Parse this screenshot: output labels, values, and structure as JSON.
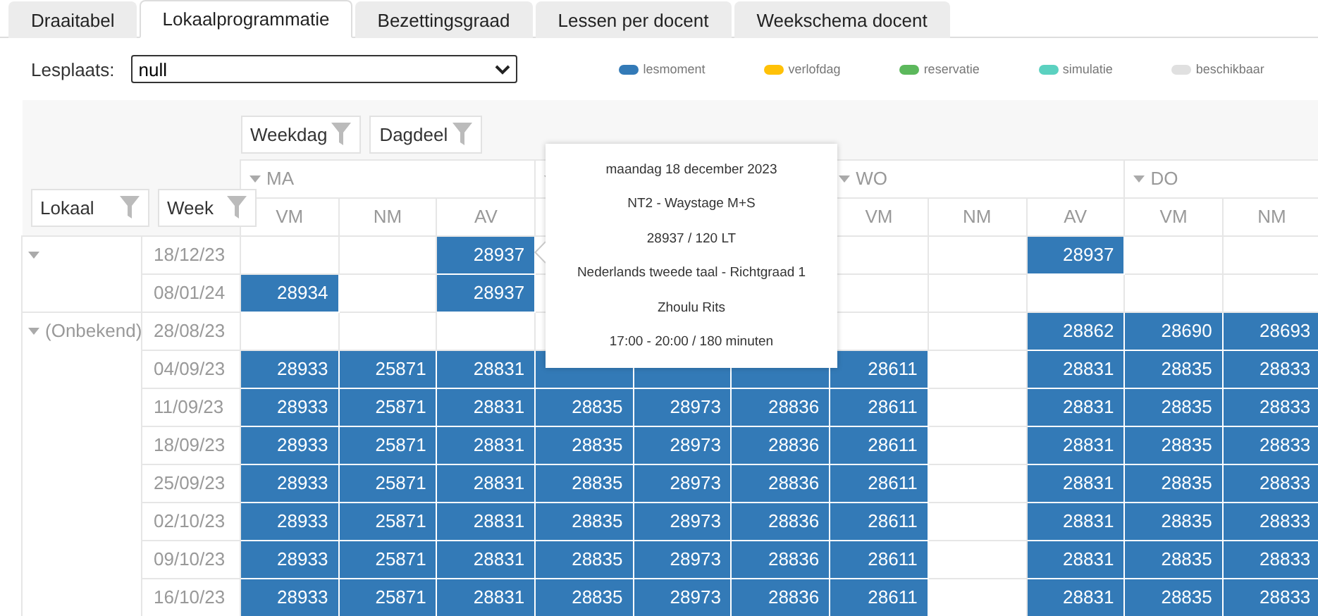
{
  "tabs": [
    {
      "label": "Draaitabel",
      "selected": false
    },
    {
      "label": "Lokaalprogrammatie",
      "selected": true
    },
    {
      "label": "Bezettingsgraad",
      "selected": false
    },
    {
      "label": "Lessen per docent",
      "selected": false
    },
    {
      "label": "Weekschema docent",
      "selected": false
    }
  ],
  "location": {
    "label": "Lesplaats:",
    "value": "null"
  },
  "legend": [
    {
      "label": "lesmoment",
      "color": "#337ab7"
    },
    {
      "label": "verlofdag",
      "color": "#ffc107"
    },
    {
      "label": "reservatie",
      "color": "#5cb85c"
    },
    {
      "label": "simulatie",
      "color": "#5bd1c0"
    },
    {
      "label": "beschikbaar",
      "color": "#e0e0e0"
    }
  ],
  "column_filters": [
    "Weekdag",
    "Dagdeel"
  ],
  "row_filters": [
    "Lokaal",
    "Week"
  ],
  "days": [
    {
      "label": "MA",
      "expanded": true,
      "parts": [
        "VM",
        "NM",
        "AV"
      ]
    },
    {
      "expanded": true
    },
    {
      "label": "WO",
      "expanded": true,
      "parts": [
        "VM",
        "NM",
        "AV"
      ]
    },
    {
      "label": "DO",
      "expanded": true,
      "parts": [
        "VM",
        "NM"
      ]
    }
  ],
  "groups": [
    {
      "expanded": true,
      "rows": [
        {
          "week": "18/12/23",
          "cells": [
            null,
            null,
            "28937",
            null,
            null,
            null,
            null,
            null,
            "28937",
            null,
            null
          ]
        },
        {
          "week": "08/01/24",
          "cells": [
            "28934",
            null,
            "28937",
            null,
            null,
            null,
            null,
            null,
            null,
            null,
            null
          ]
        }
      ]
    },
    {
      "label": "(Onbekend)",
      "expanded": true,
      "rows": [
        {
          "week": "28/08/23",
          "cells": [
            null,
            null,
            null,
            null,
            null,
            null,
            null,
            null,
            "28862",
            "28690",
            "28693"
          ]
        },
        {
          "week": "04/09/23",
          "cells": [
            "28933",
            "25871",
            "28831",
            {
              "filled": true
            },
            {
              "filled": true
            },
            {
              "filled": true
            },
            "28611",
            null,
            "28831",
            "28835",
            "28833"
          ]
        },
        {
          "week": "11/09/23",
          "cells": [
            "28933",
            "25871",
            "28831",
            "28835",
            "28973",
            "28836",
            "28611",
            null,
            "28831",
            "28835",
            "28833"
          ]
        },
        {
          "week": "18/09/23",
          "cells": [
            "28933",
            "25871",
            "28831",
            "28835",
            "28973",
            "28836",
            "28611",
            null,
            "28831",
            "28835",
            "28833"
          ]
        },
        {
          "week": "25/09/23",
          "cells": [
            "28933",
            "25871",
            "28831",
            "28835",
            "28973",
            "28836",
            "28611",
            null,
            "28831",
            "28835",
            "28833"
          ]
        },
        {
          "week": "02/10/23",
          "cells": [
            "28933",
            "25871",
            "28831",
            "28835",
            "28973",
            "28836",
            "28611",
            null,
            "28831",
            "28835",
            "28833"
          ]
        },
        {
          "week": "09/10/23",
          "cells": [
            "28933",
            "25871",
            "28831",
            "28835",
            "28973",
            "28836",
            "28611",
            null,
            "28831",
            "28835",
            "28833"
          ]
        },
        {
          "week": "16/10/23",
          "cells": [
            "28933",
            "25871",
            "28831",
            "28835",
            "28973",
            "28836",
            "28611",
            null,
            "28831",
            "28835",
            "28833"
          ]
        }
      ]
    }
  ],
  "tooltip": [
    "maandag 18 december 2023",
    "NT2 - Waystage M+S",
    "28937 / 120 LT",
    "Nederlands tweede taal - Richtgraad 1",
    "Zhoulu Rits",
    "17:00 - 20:00 / 180 minuten"
  ]
}
